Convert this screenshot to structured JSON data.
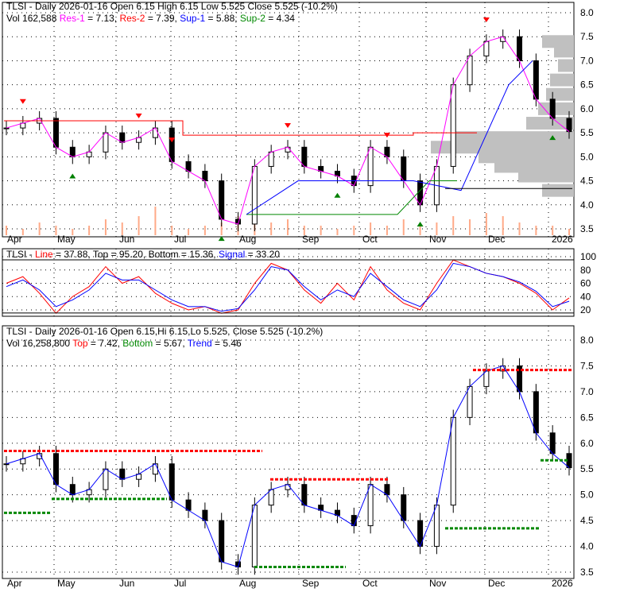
{
  "panel1": {
    "title": "TLSI - Daily 2026-01-16 Open 6.15  High 6.15  Low 5.525  Close 5.525 (-10.2%)",
    "vol": "Vol 162,588",
    "res1": "Res-1",
    "res1_val": " = 7.13, ",
    "res2": "Res-2",
    "res2_val": " = 7.39, ",
    "sup1": "Sup-1",
    "sup1_val": " = 5.88, ",
    "sup2": "Sup-2",
    "sup2_val": " = 4.34"
  },
  "panel2": {
    "prefix": "TLSI - ",
    "line": "Line",
    "line_val": " = 37.88, Top = 95.20, Bottom = 15.36, ",
    "signal": "Signal",
    "signal_val": " = 33.20"
  },
  "panel3": {
    "title": "TLSI - Daily 2026-01-16 Open 6.15,Hi 6.15,Lo 5.525, Close 5.525 (-10.2%)",
    "vol": "Vol 16,258,800 ",
    "top": "Top",
    "top_val": " = 7.42, ",
    "bottom": "Bottom",
    "bottom_val": " = 5.67, ",
    "trend": "Trend",
    "trend_val": " = 5.46"
  },
  "colors": {
    "up": "#008000",
    "down": "#ff0000",
    "res1": "#ff00ff",
    "sup1": "#0000ff",
    "sup2": "#008000",
    "volprofile": "#c0c0c0",
    "volume": "#ffaa88"
  },
  "chart_data": {
    "type": "line",
    "x_labels": [
      "Apr",
      "May",
      "Jun",
      "Jul",
      "Aug",
      "Sep",
      "Oct",
      "Nov",
      "Dec",
      "2026"
    ],
    "price_ticks": [
      "8.0",
      "7.5",
      "7.0",
      "6.5",
      "6.0",
      "5.5",
      "5.0",
      "4.5",
      "4.0",
      "3.5"
    ],
    "price_ylim": [
      3.5,
      8.0
    ],
    "osc_ticks": [
      "100",
      "80",
      "60",
      "40",
      "20"
    ],
    "osc_ylim": [
      0,
      100
    ],
    "close": [
      5.6,
      5.7,
      5.8,
      5.2,
      5.0,
      5.1,
      5.5,
      5.3,
      5.4,
      5.6,
      4.9,
      4.7,
      4.5,
      3.7,
      3.6,
      4.8,
      5.1,
      5.2,
      4.8,
      4.7,
      4.6,
      4.4,
      5.2,
      5.0,
      4.5,
      4.0,
      4.8,
      6.5,
      7.1,
      7.4,
      7.5,
      7.0,
      6.2,
      5.8,
      5.525
    ],
    "volume": [
      0.3,
      0.2,
      0.4,
      0.3,
      0.2,
      0.3,
      0.5,
      0.4,
      0.6,
      0.9,
      0.3,
      0.2,
      0.3,
      0.4,
      0.6,
      0.7,
      0.4,
      0.5,
      0.3,
      0.3,
      0.2,
      0.3,
      0.4,
      0.3,
      0.5,
      0.3,
      0.4,
      0.6,
      0.5,
      0.7,
      0.6,
      0.4,
      0.3,
      0.3,
      0.2
    ],
    "stoch_line": [
      60,
      70,
      45,
      15,
      40,
      55,
      85,
      60,
      70,
      45,
      30,
      20,
      25,
      15,
      20,
      60,
      90,
      80,
      50,
      30,
      60,
      35,
      85,
      50,
      30,
      20,
      60,
      95,
      85,
      75,
      70,
      60,
      45,
      20,
      38
    ],
    "stoch_signal": [
      55,
      65,
      50,
      25,
      35,
      50,
      75,
      65,
      65,
      50,
      35,
      25,
      25,
      18,
      22,
      50,
      85,
      80,
      55,
      35,
      50,
      40,
      75,
      55,
      35,
      25,
      50,
      90,
      85,
      75,
      70,
      62,
      48,
      25,
      33
    ]
  }
}
